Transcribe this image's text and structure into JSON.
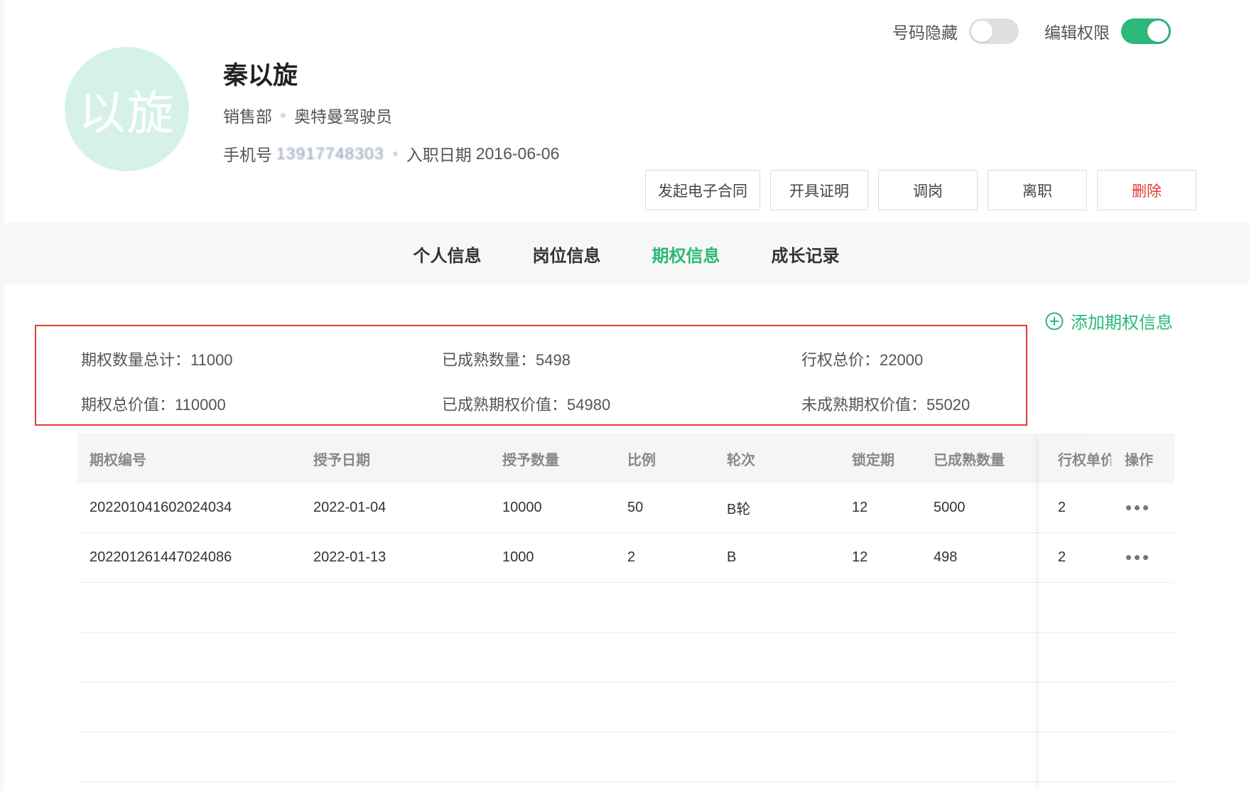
{
  "profile": {
    "avatar_text": "以旋",
    "name": "秦以旋",
    "department": "销售部",
    "position": "奥特曼驾驶员",
    "phone_label": "手机号",
    "phone_value": "13917748303",
    "hire_label": "入职日期",
    "hire_date": "2016-06-06"
  },
  "toggles": {
    "hide_number_label": "号码隐藏",
    "hide_number_on": false,
    "edit_permission_label": "编辑权限",
    "edit_permission_on": true
  },
  "actions": {
    "contract": "发起电子合同",
    "certificate": "开具证明",
    "transfer": "调岗",
    "resign": "离职",
    "delete": "删除"
  },
  "tabs": {
    "personal": "个人信息",
    "job": "岗位信息",
    "option": "期权信息",
    "growth": "成长记录",
    "active": "option"
  },
  "add_option_label": "添加期权信息",
  "summary": {
    "total_qty": "期权数量总计：11000",
    "vested_qty": "已成熟数量：5498",
    "exercise_total": "行权总价：22000",
    "total_value": "期权总价值：110000",
    "vested_value": "已成熟期权价值：54980",
    "unvested_value": "未成熟期权价值：55020"
  },
  "table": {
    "headers": [
      "期权编号",
      "授予日期",
      "授予数量",
      "比例",
      "轮次",
      "锁定期",
      "已成熟数量",
      "行权单价",
      "操作"
    ],
    "rows": [
      [
        "202201041602024034",
        "2022-01-04",
        "10000",
        "50",
        "B轮",
        "12",
        "5000",
        "2"
      ],
      [
        "202201261447024086",
        "2022-01-13",
        "1000",
        "2",
        "B",
        "12",
        "498",
        "2"
      ]
    ]
  },
  "colors": {
    "accent": "#2bb87a",
    "danger": "#e53935",
    "avatar_bg": "#d6f2e8"
  }
}
